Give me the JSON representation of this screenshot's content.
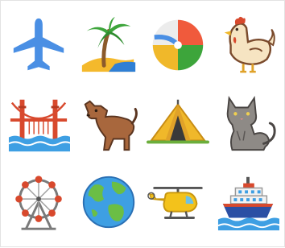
{
  "grid": {
    "icons": [
      {
        "name": "airplane",
        "color": "#4A8FE4"
      },
      {
        "name": "palm-tree-island",
        "color": "#3DA53B"
      },
      {
        "name": "beach-ball",
        "color": "#F05A3C"
      },
      {
        "name": "rooster",
        "color": "#F6E4C2"
      },
      {
        "name": "golden-gate-bridge",
        "color": "#D8492D"
      },
      {
        "name": "dog",
        "color": "#A8673D"
      },
      {
        "name": "tent",
        "color": "#F0B82A"
      },
      {
        "name": "cat",
        "color": "#8E8A86"
      },
      {
        "name": "ferris-wheel",
        "color": "#D8492D"
      },
      {
        "name": "earth-globe",
        "color": "#3E9FE3"
      },
      {
        "name": "helicopter",
        "color": "#F3C21B"
      },
      {
        "name": "cruise-ship",
        "color": "#2B4FA4"
      }
    ]
  }
}
